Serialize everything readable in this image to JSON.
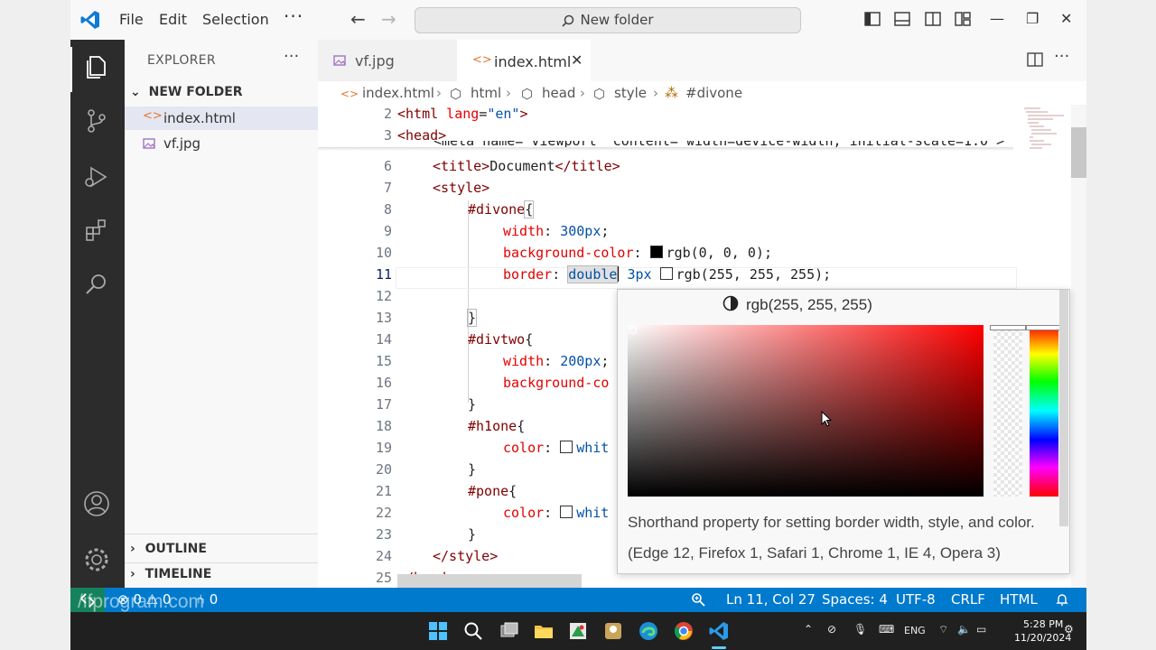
{
  "menu": {
    "file": "File",
    "edit": "Edit",
    "selection": "Selection",
    "more": "···"
  },
  "command_center": {
    "text": "New folder"
  },
  "sidebar": {
    "title": "EXPLORER",
    "more": "···",
    "folder": "NEW FOLDER",
    "files": [
      {
        "name": "index.html",
        "icon": "<>"
      },
      {
        "name": "vf.jpg",
        "icon": "image"
      }
    ],
    "outline": "OUTLINE",
    "timeline": "TIMELINE"
  },
  "tabs": [
    {
      "label": "vf.jpg"
    },
    {
      "label": "index.html",
      "close": "✕"
    }
  ],
  "breadcrumbs": [
    "index.html",
    "html",
    "head",
    "style",
    "#divone"
  ],
  "editor": {
    "line_numbers": [
      "2",
      "3",
      "6",
      "7",
      "8",
      "9",
      "10",
      "11",
      "12",
      "13",
      "14",
      "15",
      "16",
      "17",
      "18",
      "19",
      "20",
      "21",
      "22",
      "23",
      "24",
      "25"
    ],
    "ghost_line": "<meta name=\"viewport\" content=\"width=device-width, initial-scale=1.0\">",
    "lines": {
      "l2": [
        "<html",
        " lang",
        "=",
        "\"en\"",
        ">"
      ],
      "l3": [
        "<head>"
      ],
      "l6": [
        "<title>",
        "Document",
        "</title>"
      ],
      "l7": [
        "<style>"
      ],
      "l8": [
        "#divone",
        "{"
      ],
      "l9": [
        "width",
        ": ",
        "300px",
        ";"
      ],
      "l10": [
        "background-color",
        ": ",
        "rgb(0, 0, 0)",
        ";"
      ],
      "l11": [
        "border",
        ": ",
        "double",
        " 3px ",
        "rgb(255, 255, 255)",
        ";"
      ],
      "l13": [
        "}"
      ],
      "l14": [
        "#divtwo",
        "{"
      ],
      "l15": [
        "width",
        ": ",
        "200px",
        ";"
      ],
      "l16": [
        "background-co"
      ],
      "l17": [
        "}"
      ],
      "l18": [
        "#h1one",
        "{"
      ],
      "l19": [
        "color",
        ": ",
        "whit"
      ],
      "l20": [
        "}"
      ],
      "l21": [
        "#pone",
        "{"
      ],
      "l22": [
        "color",
        ": ",
        "whit"
      ],
      "l23": [
        "}"
      ],
      "l24": [
        "</style>"
      ],
      "l25": [
        "</head>"
      ]
    }
  },
  "color_picker": {
    "value": "rgb(255, 255, 255)",
    "description": "Shorthand property for setting border width, style, and color.",
    "compat": "(Edge 12, Firefox 1, Safari 1, Chrome 1, IE 4, Opera 3)"
  },
  "statusbar": {
    "problems": "⊗ 0 ⚠ 0",
    "ports": "⑃ 0",
    "position": "Ln 11, Col 27",
    "spaces": "Spaces: 4",
    "encoding": "UTF-8",
    "eol": "CRLF",
    "language": "HTML",
    "watermark": "/ifprogram.com"
  },
  "taskbar": {
    "lang": "ENG",
    "time": "5:28 PM",
    "date": "11/20/2024"
  },
  "colors": {
    "accent": "#007acc",
    "activity_bar": "#2c2c2c",
    "remote": "#16825d"
  }
}
